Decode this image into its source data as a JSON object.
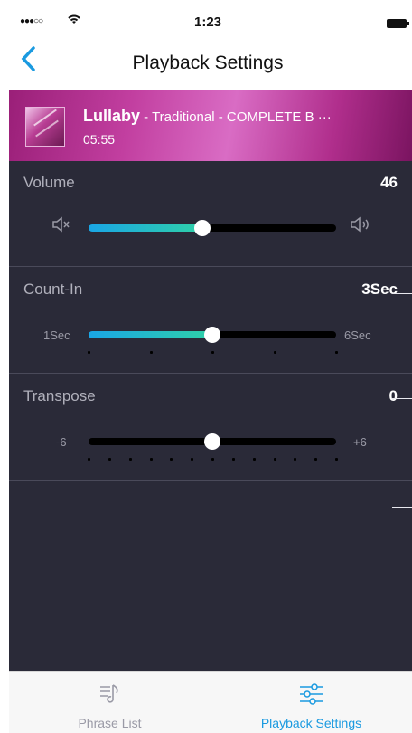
{
  "status_bar": {
    "signal": "●●●○○",
    "wifi_icon": "wifi-icon",
    "time": "1:23"
  },
  "nav": {
    "back_icon": "‹",
    "title": "Playback Settings"
  },
  "song": {
    "title": "Lullaby",
    "subtitle": " - Traditional - COMPLETE B ···",
    "duration": "05:55"
  },
  "volume": {
    "label": "Volume",
    "value": "46",
    "level": 0.46
  },
  "count_in": {
    "label": "Count-In",
    "value": "3Sec",
    "min_label": "1Sec",
    "max_label": "6Sec",
    "level": 0.5
  },
  "transpose": {
    "label": "Transpose",
    "value": "0",
    "min_label": "-6",
    "max_label": "+6",
    "level": 0.5
  },
  "tabs": [
    {
      "label": "Phrase List",
      "icon": "phrase-list-icon",
      "active": false
    },
    {
      "label": "Playback Settings",
      "icon": "sliders-icon",
      "active": true
    }
  ],
  "colors": {
    "accent": "#1a9ae0",
    "panel": "#2a2a38",
    "slider_start": "#1aa6e6",
    "slider_end": "#2fd0a8"
  }
}
